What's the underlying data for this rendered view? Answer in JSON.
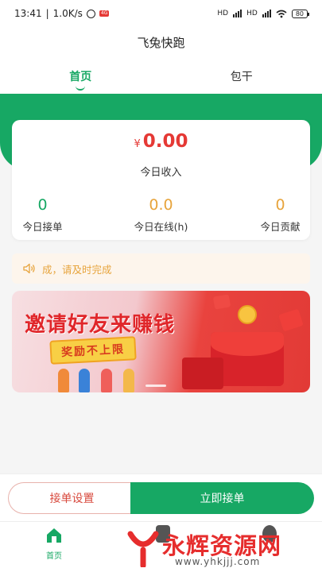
{
  "status_bar": {
    "time": "13:41",
    "speed": "1.0K/s",
    "badge": "4G",
    "network_label_1": "HD",
    "network_label_2": "HD",
    "battery": "80"
  },
  "app": {
    "title": "飞兔快跑"
  },
  "tabs": [
    {
      "label": "首页",
      "active": true
    },
    {
      "label": "包干",
      "active": false
    }
  ],
  "stats": {
    "currency": "¥",
    "income_value": "0.00",
    "income_label": "今日收入",
    "items": [
      {
        "value": "0",
        "label": "今日接单",
        "color": "#17a864"
      },
      {
        "value": "0.0",
        "label": "今日在线(h)",
        "color": "#e7a43c"
      },
      {
        "value": "0",
        "label": "今日贡献",
        "color": "#e7a43c"
      }
    ]
  },
  "notice": {
    "icon": "speaker-icon",
    "text": "成，请及时完成"
  },
  "banner": {
    "title": "邀请好友来赚钱",
    "subtitle": "奖励不上限"
  },
  "actions": {
    "settings_label": "接单设置",
    "accept_label": "立即接单"
  },
  "bottom_nav": {
    "items": [
      {
        "label": "首页",
        "icon": "home-icon",
        "active": true
      }
    ]
  },
  "watermark": {
    "text": "永辉资源网",
    "url": "www.yhkjjj.com"
  },
  "colors": {
    "primary": "#17a864",
    "accent_red": "#e53935",
    "accent_orange": "#e7a43c"
  }
}
